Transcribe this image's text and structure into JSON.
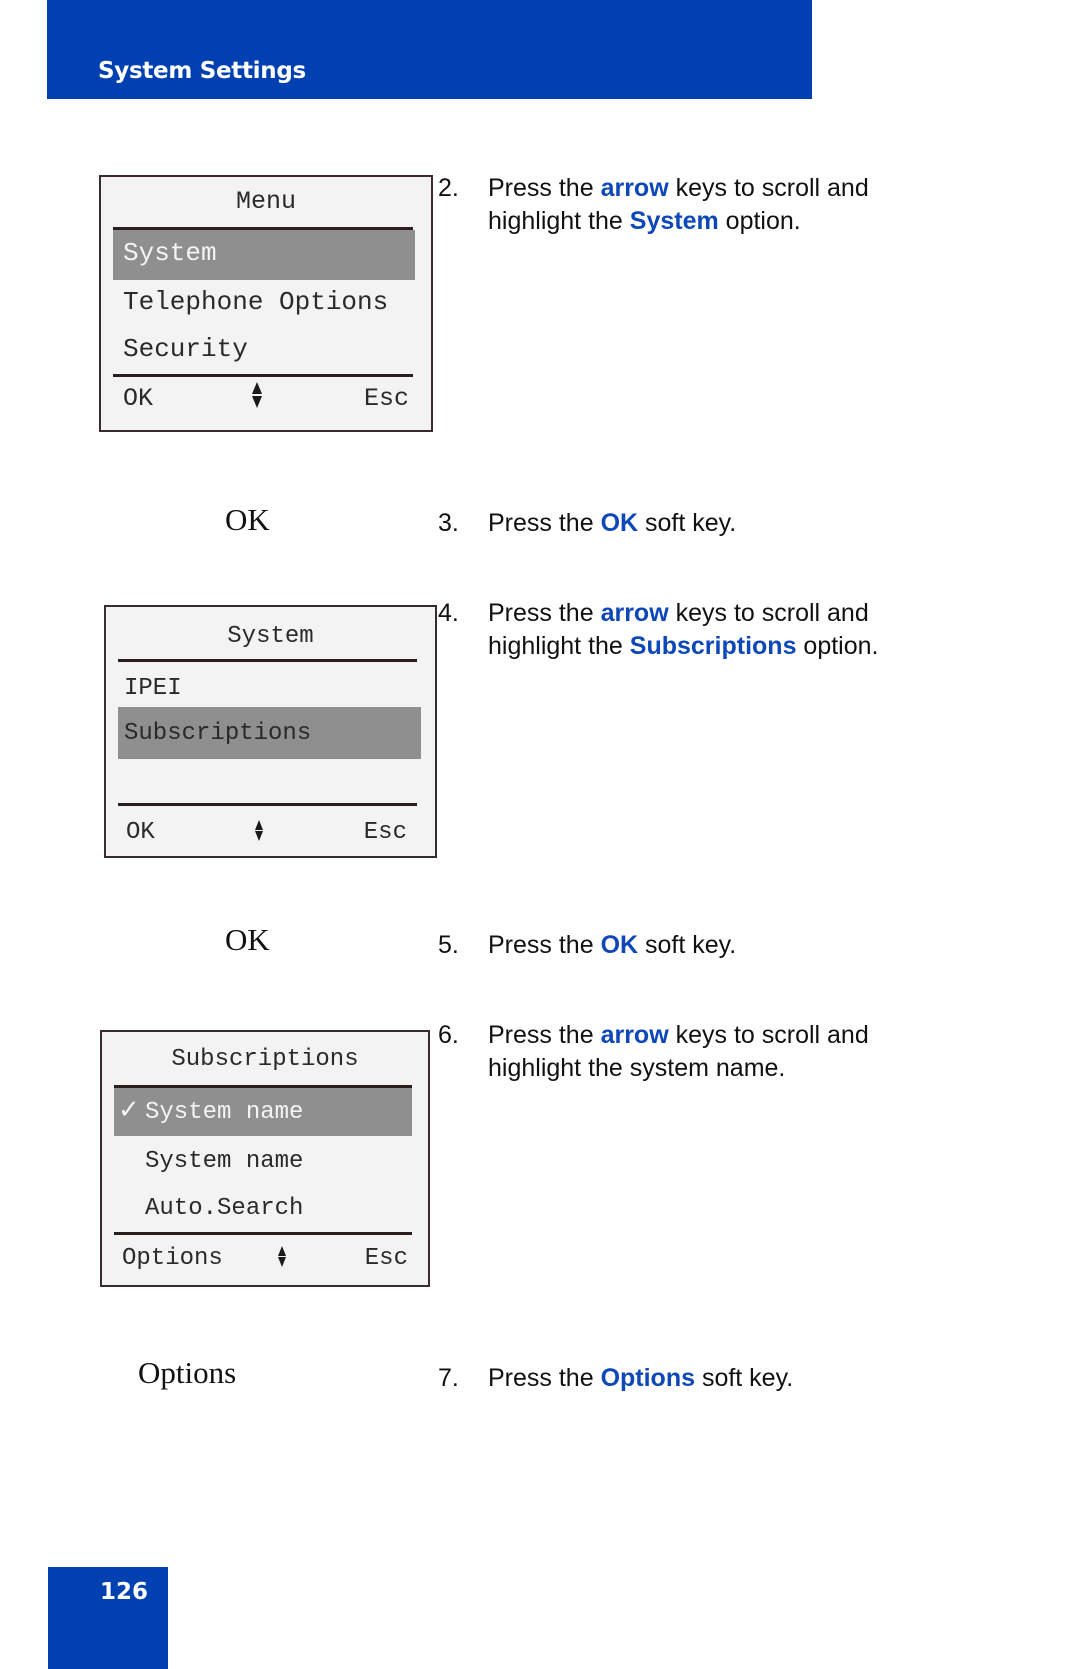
{
  "header": {
    "title": "System Settings"
  },
  "footer": {
    "page_number": "126"
  },
  "colors": {
    "brand_blue": "#0040b0",
    "highlight_text": "#0d47b8",
    "screen_bg": "#f2f3f2",
    "selection_bg": "#8f8f8f"
  },
  "screens": [
    {
      "title": "Menu",
      "items": [
        "System",
        "Telephone Options",
        "Security"
      ],
      "selected_index": 0,
      "softkeys": {
        "left": "OK",
        "center_icon": "up-down-arrows-icon",
        "right": "Esc"
      }
    },
    {
      "title": "System",
      "items": [
        "IPEI",
        "Subscriptions"
      ],
      "selected_index": 1,
      "softkeys": {
        "left": "OK",
        "center_icon": "up-down-arrows-icon",
        "right": "Esc"
      }
    },
    {
      "title": "Subscriptions",
      "items": [
        "System name",
        "System name",
        "Auto.Search"
      ],
      "checkmark": "✓",
      "checked_index": 0,
      "selected_index": 0,
      "softkeys": {
        "left": "Options",
        "center_icon": "up-down-arrows-icon",
        "right": "Esc"
      }
    }
  ],
  "key_labels": [
    "OK",
    "OK",
    "Options"
  ],
  "steps": [
    {
      "number": "2.",
      "parts": [
        "Press the ",
        "arrow",
        " keys to scroll and highlight the ",
        "System",
        " option."
      ]
    },
    {
      "number": "3.",
      "parts": [
        "Press the ",
        "OK",
        " soft key."
      ]
    },
    {
      "number": "4.",
      "parts": [
        "Press the ",
        "arrow",
        " keys to scroll and highlight the ",
        "Subscriptions",
        " option."
      ]
    },
    {
      "number": "5.",
      "parts": [
        "Press the ",
        "OK",
        " soft key."
      ]
    },
    {
      "number": "6.",
      "parts": [
        "Press the ",
        "arrow",
        " keys to scroll and highlight the system name."
      ]
    },
    {
      "number": "7.",
      "parts": [
        "Press the ",
        "Options",
        " soft key."
      ]
    }
  ]
}
